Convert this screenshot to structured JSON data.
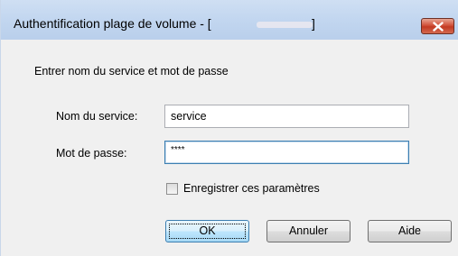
{
  "window": {
    "title_prefix": "Authentification plage de volume - [",
    "title_suffix": "]"
  },
  "dialog": {
    "prompt": "Entrer nom du service et mot de passe",
    "service_label": "Nom du service:",
    "service_value": "service",
    "password_label": "Mot de passe:",
    "password_value": "****",
    "save_label": "Enregistrer ces paramètres",
    "save_checked": false
  },
  "buttons": {
    "ok": "OK",
    "cancel": "Annuler",
    "help": "Aide"
  },
  "icons": {
    "close": "close-icon"
  }
}
